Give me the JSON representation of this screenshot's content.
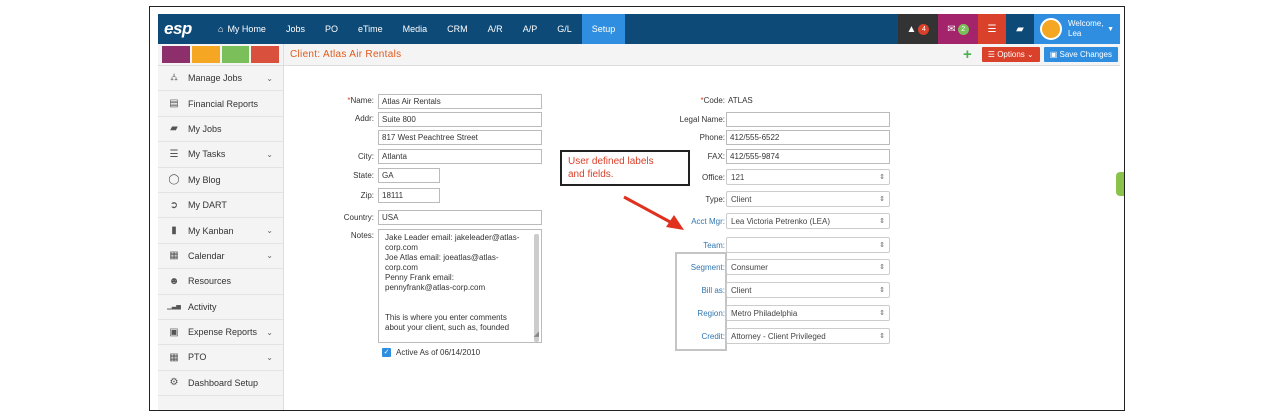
{
  "nav": {
    "logo": "esp",
    "items": [
      "My Home",
      "Jobs",
      "PO",
      "eTime",
      "Media",
      "CRM",
      "A/R",
      "A/P",
      "G/L",
      "Setup"
    ],
    "active": "Setup",
    "alerts_count": "4",
    "messages_count": "2",
    "welcome": "Welcome,",
    "user": "Lea"
  },
  "sidebar": {
    "swatches": [
      "#8c2f6b",
      "#f5a623",
      "#7bbf5a",
      "#d9503c"
    ],
    "items": [
      {
        "label": "Manage Jobs",
        "icon": "sitemap-icon",
        "glyph": "⛼",
        "chevron": true
      },
      {
        "label": "Financial Reports",
        "icon": "report-icon",
        "glyph": "▤",
        "chevron": false
      },
      {
        "label": "My Jobs",
        "icon": "folder-icon",
        "glyph": "▰",
        "chevron": false
      },
      {
        "label": "My Tasks",
        "icon": "tasks-icon",
        "glyph": "☰",
        "chevron": true
      },
      {
        "label": "My Blog",
        "icon": "chat-icon",
        "glyph": "◯",
        "chevron": false
      },
      {
        "label": "My DART",
        "icon": "dart-icon",
        "glyph": "➲",
        "chevron": false
      },
      {
        "label": "My Kanban",
        "icon": "kanban-icon",
        "glyph": "▮",
        "chevron": true
      },
      {
        "label": "Calendar",
        "icon": "calendar-icon",
        "glyph": "▦",
        "chevron": true
      },
      {
        "label": "Resources",
        "icon": "users-icon",
        "glyph": "☻",
        "chevron": false
      },
      {
        "label": "Activity",
        "icon": "activity-icon",
        "glyph": "▁▃▅",
        "chevron": false
      },
      {
        "label": "Expense Reports",
        "icon": "money-icon",
        "glyph": "▣",
        "chevron": true
      },
      {
        "label": "PTO",
        "icon": "pto-calendar-icon",
        "glyph": "▦",
        "chevron": true
      },
      {
        "label": "Dashboard Setup",
        "icon": "cogs-icon",
        "glyph": "⚙",
        "chevron": false
      }
    ]
  },
  "header": {
    "title": "Client: Atlas Air Rentals",
    "options_label": "Options",
    "save_label": "Save Changes"
  },
  "form_left": {
    "name_label": "Name:",
    "name_value": "Atlas Air Rentals",
    "addr_label": "Addr:",
    "addr1_value": "Suite 800",
    "addr2_value": "817 West Peachtree Street",
    "city_label": "City:",
    "city_value": "Atlanta",
    "state_label": "State:",
    "state_value": "GA",
    "zip_label": "Zip:",
    "zip_value": "18111",
    "country_label": "Country:",
    "country_value": "USA",
    "notes_label": "Notes:",
    "notes_lines": [
      "Jake Leader email: jakeleader@atlas-",
      "corp.com",
      "Joe Atlas email: joeatlas@atlas-",
      "corp.com",
      "Penny Frank email:",
      "pennyfrank@atlas-corp.com",
      "",
      "",
      "This is where you enter comments",
      "about your client, such as, founded"
    ],
    "active_label": "Active As of 06/14/2010"
  },
  "form_right": {
    "code_label": "Code:",
    "code_value": "ATLAS",
    "legal_label": "Legal Name:",
    "legal_value": "",
    "phone_label": "Phone:",
    "phone_value": "412/555-6522",
    "fax_label": "FAX:",
    "fax_value": "412/555-9874",
    "office_label": "Office:",
    "office_value": "121",
    "type_label": "Type:",
    "type_value": "Client",
    "acct_label": "Acct Mgr:",
    "acct_value": "Lea Victoria Petrenko (LEA)",
    "team_label": "Team:",
    "team_value": "",
    "segment_label": "Segment:",
    "segment_value": "Consumer",
    "billas_label": "Bill as:",
    "billas_value": "Client",
    "region_label": "Region:",
    "region_value": "Metro Philadelphia",
    "credit_label": "Credit:",
    "credit_value": "Attorney - Client Privileged"
  },
  "callout": {
    "line1": "User defined labels",
    "line2": "and fields."
  }
}
